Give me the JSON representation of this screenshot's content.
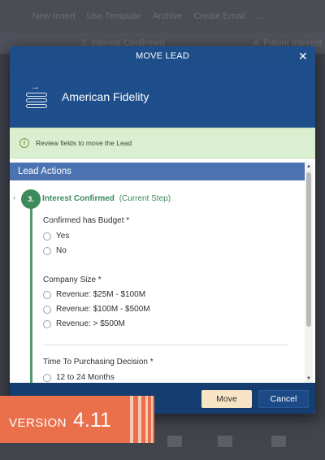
{
  "background": {
    "toolbar_items": [
      "New Insert",
      "Use Template",
      "Archive",
      "Create Email",
      "..."
    ],
    "steps": [
      "3. Interest Confirmed",
      "4. Future Interest"
    ]
  },
  "modal": {
    "title": "MOVE LEAD",
    "close_glyph": "✕",
    "lead_name": "American Fidelity",
    "notice_text": "Review fields to move the Lead",
    "section_title": "Lead Actions",
    "step": {
      "number": "3.",
      "title": "Interest Confirmed",
      "current_label": "(Current Step)"
    },
    "questions": [
      {
        "label": "Confirmed has Budget *",
        "options": [
          "Yes",
          "No"
        ]
      },
      {
        "label": "Company Size *",
        "options": [
          "Revenue: $25M - $100M",
          "Revenue: $100M - $500M",
          "Revenue: > $500M"
        ]
      },
      {
        "label": "Time To Purchasing Decision *",
        "options": [
          "12 to 24 Months"
        ]
      }
    ],
    "buttons": {
      "move": "Move",
      "cancel": "Cancel"
    }
  },
  "version_badge": {
    "word": "VERSION",
    "number": "4.11"
  },
  "colors": {
    "header_blue": "#1e4f8c",
    "section_blue": "#4b73b2",
    "step_green": "#3d8a5b",
    "notice_green": "#d9efcf",
    "move_button": "#f6e4c4",
    "badge_orange": "#e9704b"
  }
}
